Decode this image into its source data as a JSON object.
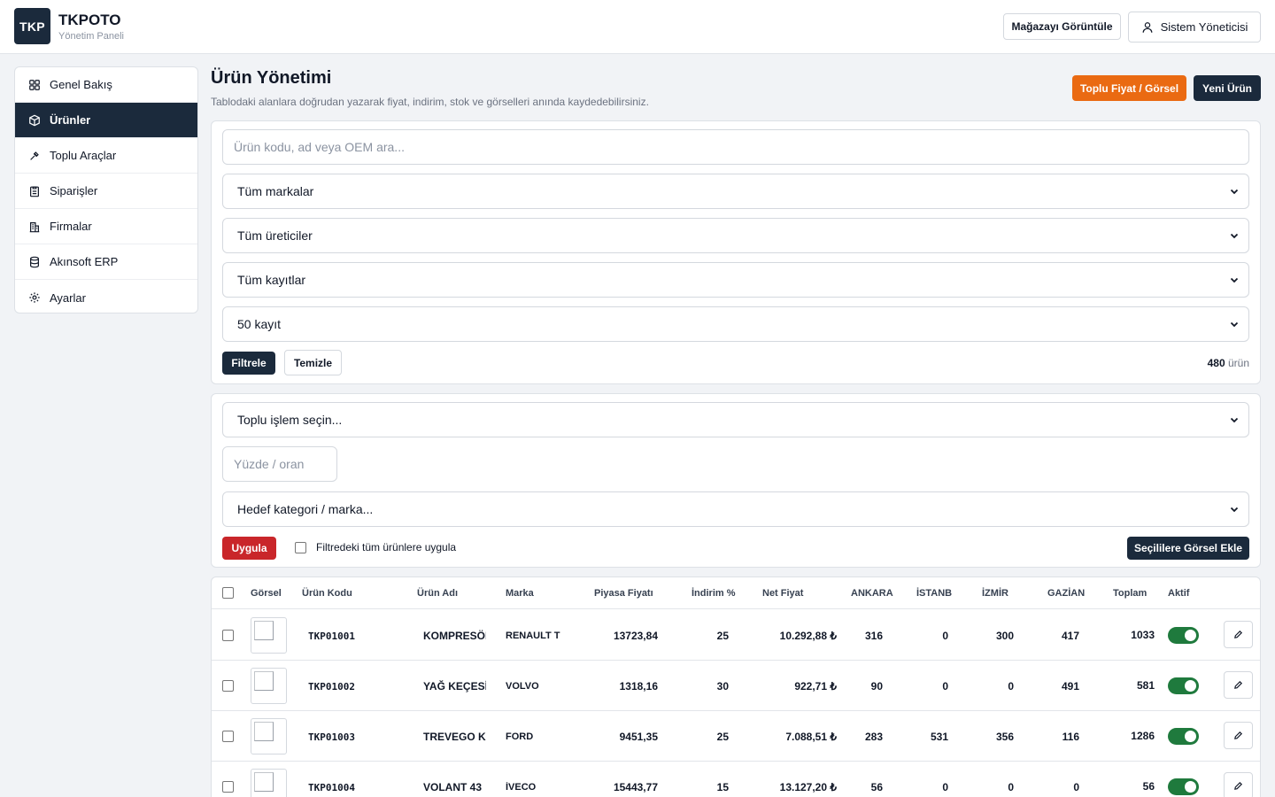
{
  "header": {
    "logo_text": "TKP",
    "brand_name": "TKPOTO",
    "brand_sub": "Yönetim Paneli",
    "store_button": "Mağazayı Görüntüle",
    "user_button": "Sistem Yöneticisi"
  },
  "sidebar": {
    "items": [
      {
        "label": "Genel Bakış",
        "icon": "grid-icon"
      },
      {
        "label": "Ürünler",
        "icon": "box-icon",
        "active": true
      },
      {
        "label": "Toplu Araçlar",
        "icon": "tool-icon"
      },
      {
        "label": "Siparişler",
        "icon": "clipboard-icon"
      },
      {
        "label": "Firmalar",
        "icon": "building-icon"
      },
      {
        "label": "Akınsoft ERP",
        "icon": "database-icon"
      },
      {
        "label": "Ayarlar",
        "icon": "gear-icon"
      }
    ]
  },
  "page": {
    "title": "Ürün Yönetimi",
    "description": "Tablodaki alanlara doğrudan yazarak fiyat, indirim, stok ve görselleri anında kaydedebilirsiniz.",
    "bulk_button": "Toplu Fiyat / Görsel",
    "new_button": "Yeni Ürün"
  },
  "filters": {
    "search_placeholder": "Ürün kodu, ad veya OEM ara...",
    "brand_select": "Tüm markalar",
    "manufacturer_select": "Tüm üreticiler",
    "record_select": "Tüm kayıtlar",
    "page_size_select": "50 kayıt",
    "filter_button": "Filtrele",
    "clear_button": "Temizle",
    "count_value": "480",
    "count_unit": "ürün"
  },
  "bulk": {
    "action_select": "Toplu işlem seçin...",
    "percent_placeholder": "Yüzde / oran",
    "target_select": "Hedef kategori / marka...",
    "apply_button": "Uygula",
    "apply_all_label": "Filtredeki tüm ürünlere uygula",
    "add_image_button": "Seçililere Görsel Ekle"
  },
  "table": {
    "headers": {
      "image": "Görsel",
      "code": "Ürün Kodu",
      "name": "Ürün Adı",
      "brand": "Marka",
      "market_price": "Piyasa Fiyatı",
      "discount": "İndirim %",
      "net_price": "Net Fiyat",
      "ankara": "ANKARA",
      "istanbul": "İSTANB",
      "izmir": "İZMİR",
      "gaziantep": "GAZİAN",
      "total": "Toplam",
      "active": "Aktif"
    },
    "rows": [
      {
        "code": "TKP01001",
        "name": "KOMPRESÖR",
        "brand": "RENAULT T",
        "market_price": "13723,84",
        "discount": "25",
        "net_price": "10.292,88 ₺",
        "ankara": "316",
        "istanbul": "0",
        "izmir": "300",
        "gaziantep": "417",
        "total": "1033",
        "active": true
      },
      {
        "code": "TKP01002",
        "name": "YAĞ KEÇESİ",
        "brand": "VOLVO",
        "market_price": "1318,16",
        "discount": "30",
        "net_price": "922,71 ₺",
        "ankara": "90",
        "istanbul": "0",
        "izmir": "0",
        "gaziantep": "491",
        "total": "581",
        "active": true
      },
      {
        "code": "TKP01003",
        "name": "TREVEGO K",
        "brand": "FORD",
        "market_price": "9451,35",
        "discount": "25",
        "net_price": "7.088,51 ₺",
        "ankara": "283",
        "istanbul": "531",
        "izmir": "356",
        "gaziantep": "116",
        "total": "1286",
        "active": true
      },
      {
        "code": "TKP01004",
        "name": "VOLANT 43",
        "brand": "İVECO",
        "market_price": "15443,77",
        "discount": "15",
        "net_price": "13.127,20 ₺",
        "ankara": "56",
        "istanbul": "0",
        "izmir": "0",
        "gaziantep": "0",
        "total": "56",
        "active": true
      }
    ]
  }
}
